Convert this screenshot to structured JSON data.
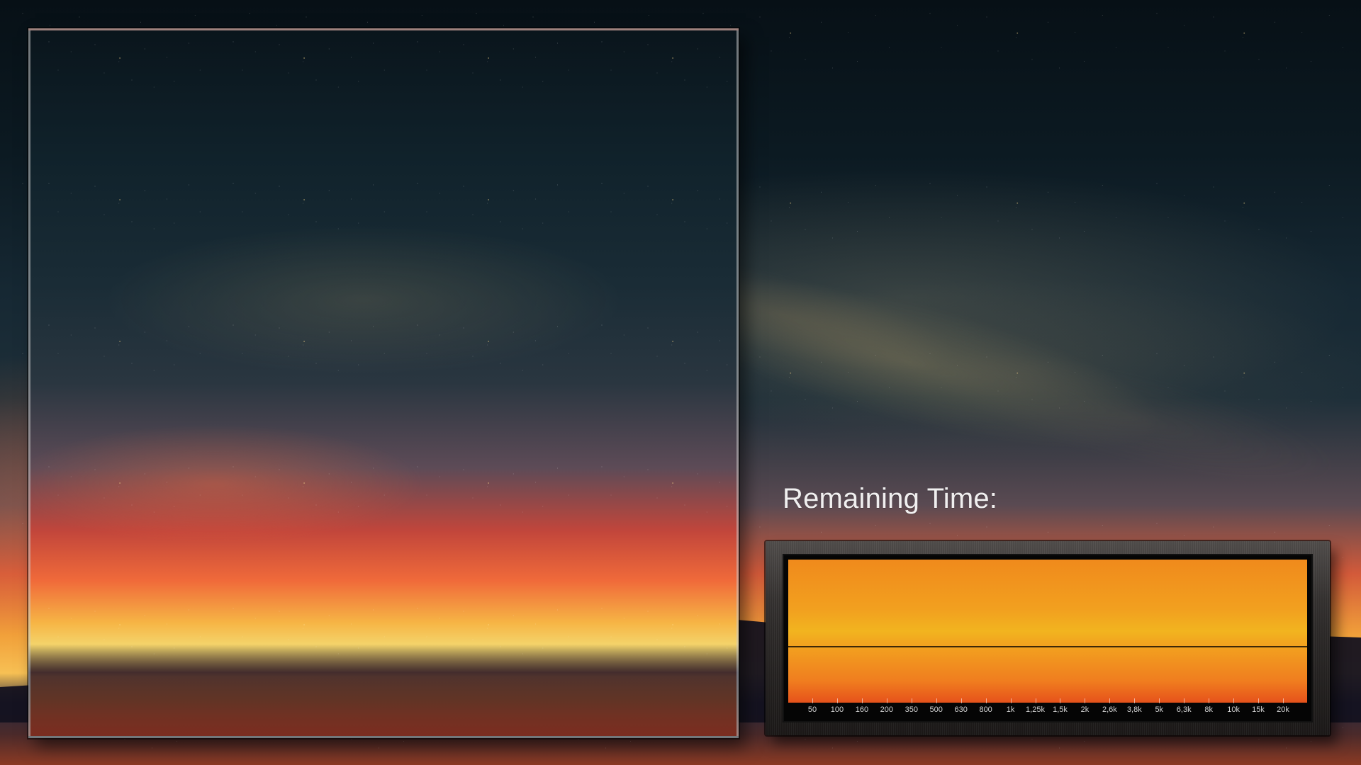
{
  "screen": {
    "remaining_time_label": "Remaining Time:"
  },
  "meter": {
    "tick_labels": [
      "50",
      "100",
      "160",
      "200",
      "350",
      "500",
      "630",
      "800",
      "1k",
      "1,25k",
      "1,5k",
      "2k",
      "2,6k",
      "3,8k",
      "5k",
      "6,3k",
      "8k",
      "10k",
      "15k",
      "20k"
    ],
    "colors": {
      "top": "#f08a1c",
      "mid": "#f2b41f",
      "bottom": "#e6521b",
      "frame": "#2a2726"
    }
  }
}
